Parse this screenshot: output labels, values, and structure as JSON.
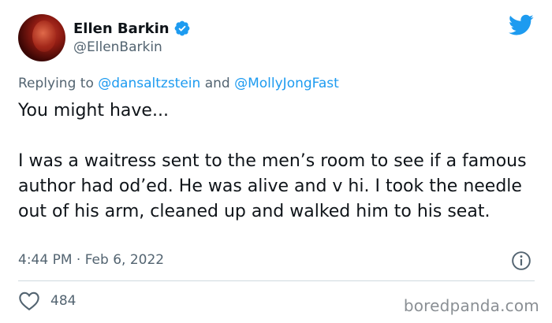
{
  "user": {
    "display_name": "Ellen Barkin",
    "handle": "@EllenBarkin",
    "verified_icon": "verified-badge-icon"
  },
  "reply": {
    "prefix": "Replying to ",
    "mention_1": "@dansaltzstein",
    "joiner": " and ",
    "mention_2": "@MollyJongFast"
  },
  "tweet": {
    "text": "You might have...\n\nI was a waitress sent to the men’s room to see if a famous author had od’ed. He was alive and v hi. I took the needle out of his arm, cleaned up and walked him to his seat.",
    "timestamp": "4:44 PM · Feb 6, 2022"
  },
  "actions": {
    "like_count": "484"
  },
  "watermark": "boredpanda.com",
  "colors": {
    "accent": "#1d9bf0",
    "secondary_text": "#536471",
    "primary_text": "#0f1419",
    "divider": "#cfd9de"
  },
  "icons": [
    "twitter-bird-icon",
    "verified-badge-icon",
    "info-icon",
    "heart-icon"
  ]
}
